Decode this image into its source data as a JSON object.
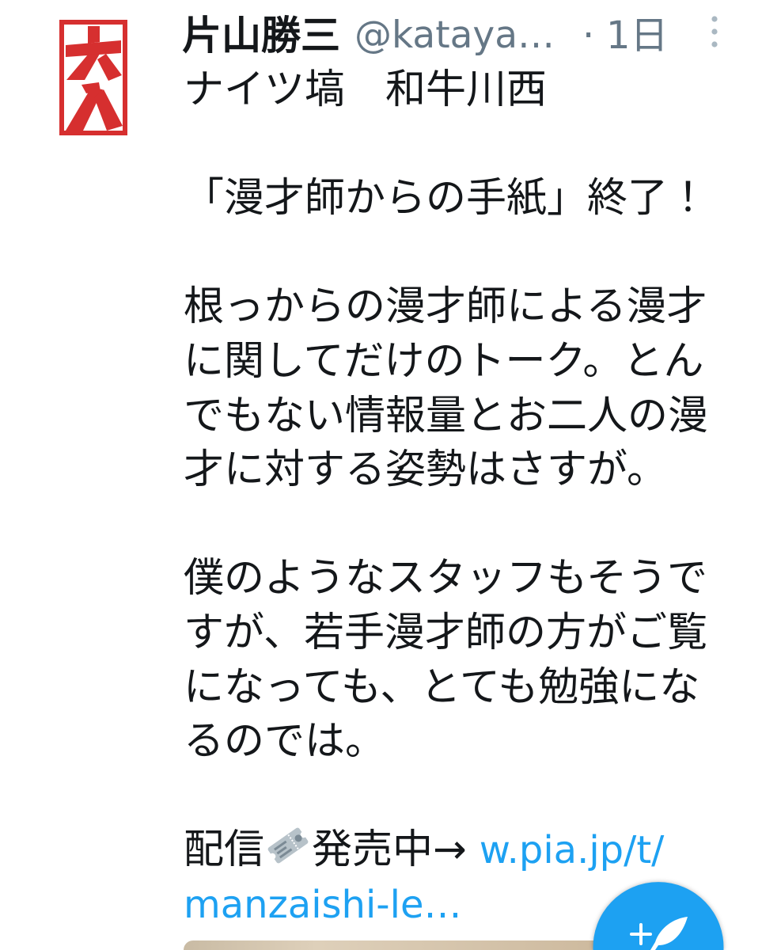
{
  "tweet": {
    "author": {
      "display_name": "片山勝三",
      "handle": "@kataya…",
      "avatar_logo_text": "大入"
    },
    "separator": "·",
    "timestamp": "1日",
    "menu_icon": "more-vertical-icon",
    "paragraphs": [
      "ナイツ塙　和牛川西",
      "「漫才師からの手紙」終了！",
      "根っからの漫才師による漫才に関してだけのトーク。とんでもない情報量とお二人の漫才に対する姿勢はさすが。",
      "僕のようなスタッフもそうですが、若手漫才師の方がご覧になっても、とても勉強になるのでは。"
    ],
    "promo_line": {
      "before_emoji": "配信",
      "emoji_icon": "ticket-icon",
      "after_emoji": "発売中→",
      "link_text_lines": [
        "w.pia.jp/t/",
        "manzaishi-le…"
      ]
    }
  },
  "compose_button": {
    "icon": "compose-tweet-icon"
  },
  "theme": {
    "text": "#14171a",
    "secondary_text": "#657786",
    "accent": "#1da1f2",
    "menu_icon": "#aab8c2",
    "avatar_red": "#d62f2f"
  }
}
